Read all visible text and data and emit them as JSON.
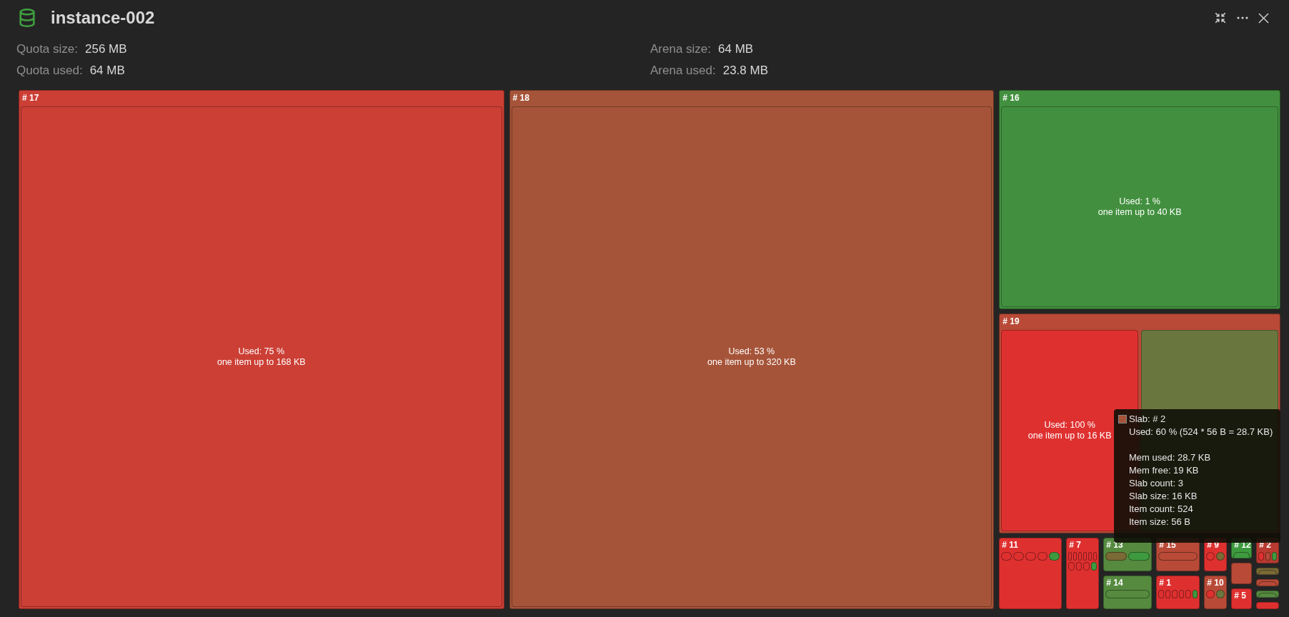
{
  "header": {
    "title": "instance-002"
  },
  "stats": [
    {
      "label": "Quota size:",
      "value": "256 MB"
    },
    {
      "label": "Arena size:",
      "value": "64 MB"
    },
    {
      "label": "Quota used:",
      "value": "64 MB"
    },
    {
      "label": "Arena used:",
      "value": "23.8 MB"
    }
  ],
  "treemap": {
    "large": [
      {
        "label": "# 17",
        "color": "#cc3f35",
        "slabs": [
          {
            "color": "#cc3f35",
            "used": "Used: 75 %",
            "limit": "one item up to 168 KB"
          }
        ]
      },
      {
        "label": "# 18",
        "color": "#a65439",
        "slabs": [
          {
            "color": "#a65439",
            "used": "Used: 53 %",
            "limit": "one item up to 320 KB"
          }
        ]
      },
      {
        "label": "# 16",
        "color": "#42903f",
        "slabs": [
          {
            "color": "#42903f",
            "used": "Used: 1 %",
            "limit": "one item up to 40 KB"
          }
        ]
      },
      {
        "label": "# 19",
        "color": "#b84a37",
        "slabs": [
          {
            "color": "#df3030",
            "used": "Used: 100 %",
            "limit": "one item up to 16 KB"
          },
          {
            "color": "#69773e"
          }
        ]
      }
    ],
    "small": [
      {
        "label": "# 11",
        "color": "#df3030",
        "slabs": [
          {
            "color": "#df3030"
          },
          {
            "color": "#df3030"
          },
          {
            "color": "#df3030"
          },
          {
            "color": "#df3030"
          },
          {
            "color": "#3e9a3e"
          }
        ]
      },
      {
        "label": "# 7",
        "color": "#df3030",
        "slabs": [
          {
            "color": "#df3030"
          },
          {
            "color": "#df3030"
          },
          {
            "color": "#df3030"
          },
          {
            "color": "#df3030"
          },
          {
            "color": "#df3030"
          },
          {
            "color": "#df3030"
          },
          {
            "color": "#df3030"
          },
          {
            "color": "#df3030"
          },
          {
            "color": "#df3030"
          },
          {
            "color": "#3e9a3e"
          }
        ]
      },
      {
        "label": "# 13",
        "color": "#558a3f",
        "slabs": [
          {
            "color": "#7a6a35"
          },
          {
            "color": "#3e9a3e"
          }
        ]
      },
      {
        "label": "# 14",
        "color": "#558a3f",
        "slabs": [
          {
            "color": "#558a3f"
          }
        ]
      },
      {
        "label": "# 15",
        "color": "#b84a37",
        "slabs": [
          {
            "color": "#b84a37"
          }
        ]
      },
      {
        "label": "# 1",
        "color": "#df3030",
        "slabs": [
          {
            "color": "#df3030"
          },
          {
            "color": "#df3030"
          },
          {
            "color": "#df3030"
          },
          {
            "color": "#df3030"
          },
          {
            "color": "#df3030"
          },
          {
            "color": "#3e9a3e"
          }
        ]
      },
      {
        "label": "# 9",
        "color": "#df3030",
        "slabs": [
          {
            "color": "#df3030"
          },
          {
            "color": "#7a6a35"
          }
        ]
      },
      {
        "label": "# 10",
        "color": "#b84a37",
        "slabs": [
          {
            "color": "#df3030"
          },
          {
            "color": "#69773e"
          }
        ]
      },
      {
        "label": "# 12",
        "color": "#3e9a3e",
        "slabs": [
          {
            "color": "#3e9a3e"
          }
        ]
      },
      {
        "color": "#b84a37"
      },
      {
        "label": "# 5",
        "color": "#df3030"
      },
      {
        "label": "# 2",
        "color": "#b83a30",
        "slabs": [
          {
            "color": "#df3030"
          },
          {
            "color": "#b84a37"
          },
          {
            "color": "#3e9a3e"
          }
        ]
      },
      {
        "color": "#7a6a35",
        "slabs": [
          {
            "color": "#7a6a35"
          }
        ]
      },
      {
        "color": "#b84a37",
        "slabs": [
          {
            "color": "#b84a37"
          }
        ]
      },
      {
        "color": "#558a3f",
        "slabs": [
          {
            "color": "#558a3f"
          }
        ]
      },
      {
        "color": "#df3030"
      }
    ]
  },
  "tooltip": {
    "color": "#a65439",
    "title": "Slab: # 2",
    "used": "Used: 60 % (524 * 56 B = 28.7 KB)",
    "details": [
      "Mem used: 28.7 KB",
      "Mem free: 19 KB",
      "Slab count: 3",
      "Slab size: 16 KB",
      "Item count: 524",
      "Item size: 56 B"
    ]
  }
}
